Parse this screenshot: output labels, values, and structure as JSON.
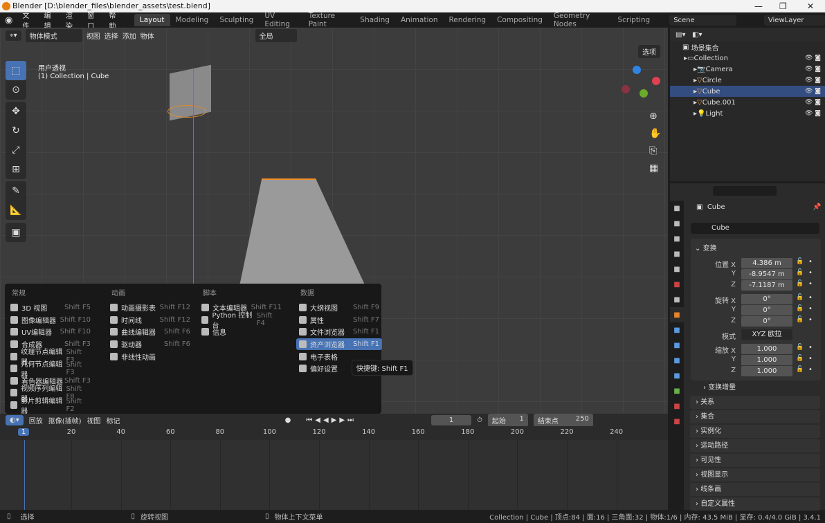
{
  "window": {
    "title": "Blender [D:\\blender_files\\blender_assets\\test.blend]",
    "min": "—",
    "max": "❐",
    "close": "✕"
  },
  "menus": [
    "文件",
    "编辑",
    "渲染",
    "窗口",
    "帮助"
  ],
  "workspaces": [
    "Layout",
    "Modeling",
    "Sculpting",
    "UV Editing",
    "Texture Paint",
    "Shading",
    "Animation",
    "Rendering",
    "Compositing",
    "Geometry Nodes",
    "Scripting"
  ],
  "scene": "Scene",
  "view_layer": "ViewLayer",
  "viewport": {
    "mode": "物体模式",
    "menus": [
      "视图",
      "选择",
      "添加",
      "物体"
    ],
    "transform_orient": "全局",
    "options": "选项",
    "view_name": "用户透视",
    "collection_info": "(1) Collection | Cube"
  },
  "editor_menu": {
    "columns": [
      {
        "header": "常规",
        "items": [
          {
            "label": "3D 视图",
            "key": "Shift F5"
          },
          {
            "label": "图像编辑器",
            "key": "Shift F10"
          },
          {
            "label": "UV编辑器",
            "key": "Shift F10"
          },
          {
            "label": "合成器",
            "key": "Shift F3"
          },
          {
            "label": "纹理节点编辑器",
            "key": "Shift F3"
          },
          {
            "label": "几何节点编辑器",
            "key": "Shift F3"
          },
          {
            "label": "着色器编辑器",
            "key": "Shift F3"
          },
          {
            "label": "视频序列编辑器",
            "key": "Shift F8"
          },
          {
            "label": "影片剪辑编辑器",
            "key": "Shift F2"
          }
        ]
      },
      {
        "header": "动画",
        "items": [
          {
            "label": "动画摄影表",
            "key": "Shift F12"
          },
          {
            "label": "时间线",
            "key": "Shift F12"
          },
          {
            "label": "曲线编辑器",
            "key": "Shift F6"
          },
          {
            "label": "驱动器",
            "key": "Shift F6"
          },
          {
            "label": "非线性动画",
            "key": ""
          }
        ]
      },
      {
        "header": "脚本",
        "items": [
          {
            "label": "文本编辑器",
            "key": "Shift F11"
          },
          {
            "label": "Python 控制台",
            "key": "Shift F4"
          },
          {
            "label": "信息",
            "key": ""
          }
        ]
      },
      {
        "header": "数据",
        "items": [
          {
            "label": "大纲视图",
            "key": "Shift F9"
          },
          {
            "label": "属性",
            "key": "Shift F7"
          },
          {
            "label": "文件浏览器",
            "key": "Shift F1"
          },
          {
            "label": "资产浏览器",
            "key": "Shift F1"
          },
          {
            "label": "电子表格",
            "key": ""
          },
          {
            "label": "偏好设置",
            "key": ""
          }
        ]
      }
    ],
    "selected": "资产浏览器",
    "tooltip": "快捷键: Shift F1"
  },
  "timeline": {
    "menus": [
      "回放",
      "抠像(插帧)",
      "视图",
      "标记"
    ],
    "current_frame": "1",
    "start_label": "起始",
    "start": "1",
    "end_label": "结束点",
    "end": "250",
    "ticks": [
      "20",
      "40",
      "60",
      "80",
      "100",
      "120",
      "140",
      "160",
      "180",
      "200",
      "220",
      "240"
    ],
    "playhead": "1"
  },
  "outliner": {
    "root": "场景集合",
    "items": [
      {
        "name": "Collection"
      },
      {
        "name": "Camera"
      },
      {
        "name": "Circle"
      },
      {
        "name": "Cube"
      },
      {
        "name": "Cube.001"
      },
      {
        "name": "Light"
      }
    ]
  },
  "properties": {
    "object_name": "Cube",
    "datablock": "Cube",
    "transform_label": "变换",
    "location_label": "位置 X",
    "location": [
      "4.386 m",
      "-8.9547 m",
      "-7.1187 m"
    ],
    "rotation_label": "旋转 X",
    "rotation": [
      "0°",
      "0°",
      "0°"
    ],
    "mode_label": "模式",
    "mode": "XYZ 欧拉",
    "scale_label": "缩放 X",
    "scale": [
      "1.000",
      "1.000",
      "1.000"
    ],
    "y": "Y",
    "z": "Z",
    "panels": [
      "变换增量",
      "关系",
      "集合",
      "实例化",
      "运动路径",
      "可见性",
      "视图显示",
      "线条画",
      "自定义属性"
    ]
  },
  "statusbar": {
    "select": "选择",
    "rotate": "旋转视图",
    "context": "物体上下文菜单",
    "info": "Collection | Cube | 顶点:84 | 面:16 | 三角面:32 | 物体:1/6 | 内存: 43.5 MiB | 显存: 0.4/4.0 GiB | 3.4.1"
  }
}
